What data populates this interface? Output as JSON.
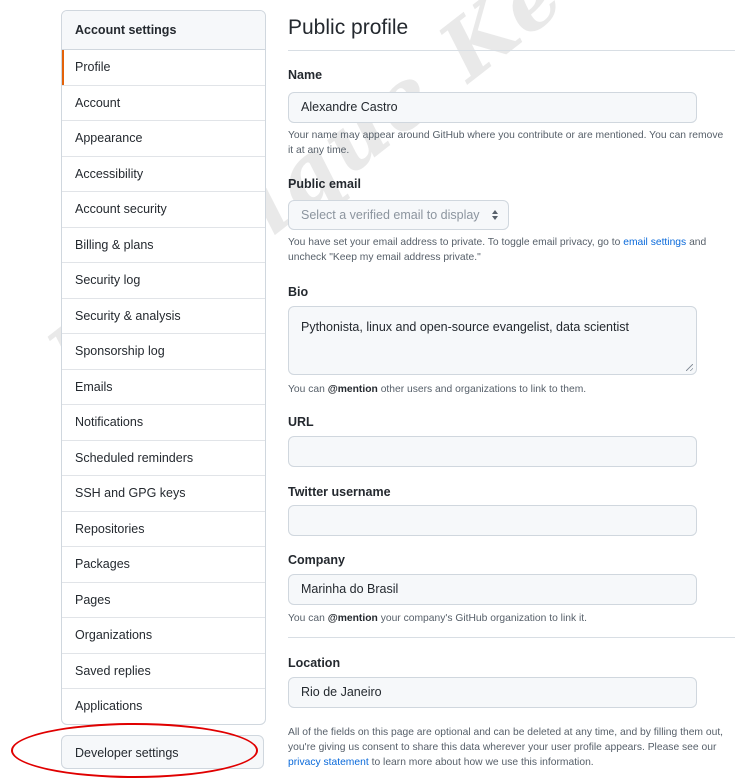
{
  "sidebar": {
    "header": "Account settings",
    "items": [
      {
        "label": "Profile",
        "selected": true
      },
      {
        "label": "Account"
      },
      {
        "label": "Appearance"
      },
      {
        "label": "Accessibility"
      },
      {
        "label": "Account security"
      },
      {
        "label": "Billing & plans"
      },
      {
        "label": "Security log"
      },
      {
        "label": "Security & analysis"
      },
      {
        "label": "Sponsorship log"
      },
      {
        "label": "Emails"
      },
      {
        "label": "Notifications"
      },
      {
        "label": "Scheduled reminders"
      },
      {
        "label": "SSH and GPG keys"
      },
      {
        "label": "Repositories"
      },
      {
        "label": "Packages"
      },
      {
        "label": "Pages"
      },
      {
        "label": "Organizations"
      },
      {
        "label": "Saved replies"
      },
      {
        "label": "Applications"
      }
    ],
    "developer_settings": "Developer settings",
    "annotation_color": "#e00000"
  },
  "main": {
    "title": "Public profile",
    "name": {
      "label": "Name",
      "value": "Alexandre Castro",
      "note": "Your name may appear around GitHub where you contribute or are mentioned. You can remove it at any time."
    },
    "public_email": {
      "label": "Public email",
      "select_value": "Select a verified email to display",
      "note_before": "You have set your email address to private. To toggle email privacy, go to",
      "note_link": "email settings",
      "note_after": "and uncheck \"Keep my email address private.\""
    },
    "bio": {
      "label": "Bio",
      "value": "Pythonista, linux and open-source evangelist, data scientist",
      "note_before": "You can",
      "note_mention": "@mention",
      "note_after": "other users and organizations to link to them."
    },
    "url": {
      "label": "URL",
      "value": ""
    },
    "twitter": {
      "label": "Twitter username",
      "value": ""
    },
    "company": {
      "label": "Company",
      "value": "Marinha do Brasil",
      "note_before": "You can",
      "note_mention": "@mention",
      "note_after": "your company's GitHub organization to link it."
    },
    "location": {
      "label": "Location",
      "value": "Rio de Janeiro"
    },
    "footer": {
      "text_before": "All of the fields on this page are optional and can be deleted at any time, and by filling them out, you're giving us consent to share this data wherever your user profile appears. Please see our",
      "link": "privacy statement",
      "text_after": "to learn more about how we use this information."
    }
  },
  "watermark": "Henrique Ke",
  "colors": {
    "selected_accent": "#e36209",
    "link": "#0969da",
    "border": "#d0d7de"
  }
}
